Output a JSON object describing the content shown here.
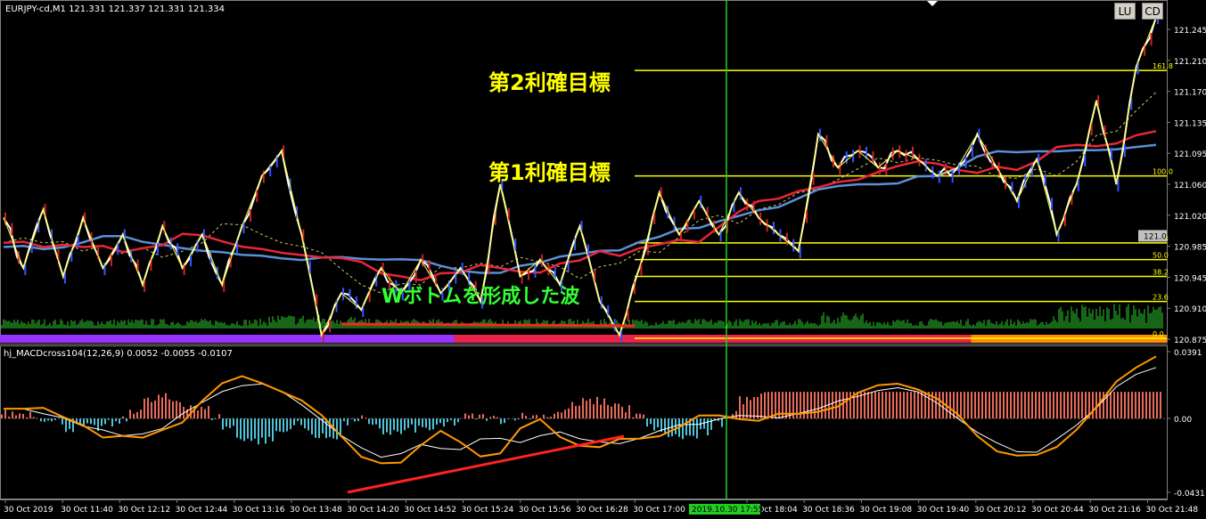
{
  "window": {
    "symbol_info": "EURJPY-cd,M1  121.331 121.337 121.331 121.334",
    "lu_label": "LU",
    "cd_label": "CD"
  },
  "annotations": {
    "target2": "第2利確目標",
    "target1": "第1利確目標",
    "wbottom": "Wボトムを形成した波"
  },
  "colors": {
    "price": "#ffffff",
    "zigzag": "#ffff33",
    "fib": "#ffff00",
    "ma_red": "#e8263a",
    "ma_blue": "#5b8fd6",
    "volume": "#2ecc2e",
    "vline": "#22cc22",
    "macd_line": "#ff9900",
    "macd_signal": "#ffffff",
    "trend": "#ff2222",
    "band_purple": "#9933ff",
    "band_red": "#e8234a",
    "band_orange": "#ff8c00"
  },
  "chart_data": [
    {
      "type": "line",
      "title": "EURJPY-cd,M1",
      "ylim": [
        120.875,
        121.245
      ],
      "y_ticks": [
        "121.245",
        "121.210",
        "121.170",
        "121.135",
        "121.095",
        "121.060",
        "121.020",
        "120.985",
        "120.945",
        "120.910",
        "120.875"
      ],
      "current_price_label": "121.0",
      "x_ticks": [
        "30 Oct 2019",
        "30 Oct 11:40",
        "30 Oct 12:12",
        "30 Oct 12:44",
        "30 Oct 13:16",
        "30 Oct 13:48",
        "30 Oct 14:20",
        "30 Oct 14:52",
        "30 Oct 15:24",
        "30 Oct 15:56",
        "30 Oct 16:28",
        "30 Oct 17:00",
        "30 Oct 18:04",
        "30 Oct 18:36",
        "30 Oct 19:08",
        "30 Oct 19:40",
        "30 Oct 20:12",
        "30 Oct 20:44",
        "30 Oct 21:16",
        "30 Oct 21:48"
      ],
      "cursor_time_label": "2019.10.30 17:55",
      "fib_levels": [
        {
          "label": "161.8",
          "price": 121.196
        },
        {
          "label": "100.0",
          "price": 121.07
        },
        {
          "label": "61.8",
          "price": 120.99
        },
        {
          "label": "50.0",
          "price": 120.97
        },
        {
          "label": "38.2",
          "price": 120.95
        },
        {
          "label": "23.6",
          "price": 120.92
        },
        {
          "label": "0.0",
          "price": 120.876
        }
      ],
      "zigzag_points": [
        [
          0,
          121.02
        ],
        [
          1.5,
          120.96
        ],
        [
          3,
          121.03
        ],
        [
          4.5,
          120.95
        ],
        [
          6,
          121.02
        ],
        [
          7.5,
          120.96
        ],
        [
          9,
          121.0
        ],
        [
          10.5,
          120.94
        ],
        [
          12,
          121.01
        ],
        [
          13.5,
          120.96
        ],
        [
          15,
          121.0
        ],
        [
          16.5,
          120.94
        ],
        [
          18,
          121.01
        ],
        [
          19.5,
          121.07
        ],
        [
          21,
          121.1
        ],
        [
          22.5,
          121.0
        ],
        [
          24,
          120.88
        ],
        [
          25.5,
          120.93
        ],
        [
          27,
          120.91
        ],
        [
          28.5,
          120.96
        ],
        [
          30,
          120.93
        ],
        [
          31.5,
          120.97
        ],
        [
          33,
          120.93
        ],
        [
          34.5,
          120.96
        ],
        [
          36,
          120.92
        ],
        [
          37.5,
          121.06
        ],
        [
          39,
          120.95
        ],
        [
          40.5,
          120.97
        ],
        [
          42,
          120.94
        ],
        [
          43.5,
          121.01
        ],
        [
          45,
          120.92
        ],
        [
          46.5,
          120.88
        ],
        [
          48,
          120.96
        ],
        [
          49.5,
          121.05
        ],
        [
          51,
          121.0
        ],
        [
          52.5,
          121.04
        ],
        [
          54,
          121.0
        ],
        [
          55.5,
          121.05
        ],
        [
          57,
          121.02
        ],
        [
          58.5,
          121.0
        ],
        [
          60,
          120.98
        ],
        [
          61.5,
          121.12
        ],
        [
          63,
          121.08
        ],
        [
          64.5,
          121.1
        ],
        [
          66,
          121.08
        ],
        [
          67.5,
          121.1
        ],
        [
          69,
          121.09
        ],
        [
          70.5,
          121.07
        ],
        [
          72,
          121.08
        ],
        [
          73.5,
          121.12
        ],
        [
          75,
          121.08
        ],
        [
          76.5,
          121.04
        ],
        [
          78,
          121.09
        ],
        [
          79.5,
          121.0
        ],
        [
          81,
          121.06
        ],
        [
          82.5,
          121.16
        ],
        [
          84,
          121.06
        ],
        [
          85.5,
          121.2
        ],
        [
          87,
          121.26
        ]
      ],
      "volume_note": "green volume histogram at bottom of price panel",
      "band_segments": [
        {
          "color": "purple",
          "from": 0,
          "to": 30
        },
        {
          "color": "red",
          "from": 30,
          "to": 69
        },
        {
          "color": "orange",
          "from": 69,
          "to": 87
        }
      ]
    },
    {
      "type": "line",
      "title": "hj_MACDcross104(12,26,9) 0.0052 -0.0055 -0.0107",
      "ylim": [
        -0.0431,
        0.0391
      ],
      "y_ticks": [
        "0.0391",
        "0.00",
        "-0.0431"
      ]
    }
  ]
}
